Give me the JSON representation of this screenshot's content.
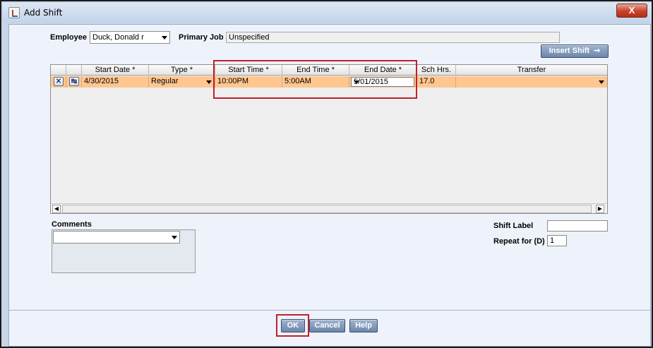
{
  "window": {
    "title": "Add Shift",
    "close_label": "X"
  },
  "employee": {
    "label": "Employee",
    "value": "Duck, Donald r"
  },
  "primary_job": {
    "label": "Primary Job",
    "value": "Unspecified"
  },
  "insert_shift": {
    "label": "Insert Shift"
  },
  "grid": {
    "headers": {
      "start_date": "Start Date *",
      "type": "Type *",
      "start_time": "Start Time *",
      "end_time": "End Time *",
      "end_date": "End Date *",
      "sch_hrs": "Sch Hrs.",
      "transfer": "Transfer"
    },
    "rows": [
      {
        "start_date": "4/30/2015",
        "type": "Regular",
        "start_time": "10:00PM",
        "end_time": "5:00AM",
        "end_date": "5/01/2015",
        "sch_hrs": "17.0",
        "transfer": ""
      }
    ]
  },
  "comments": {
    "label": "Comments",
    "value": ""
  },
  "shift_label": {
    "label": "Shift Label",
    "value": ""
  },
  "repeat_for": {
    "label": "Repeat for (D)",
    "value": "1"
  },
  "footer": {
    "ok": "OK",
    "cancel": "Cancel",
    "help": "Help"
  },
  "colors": {
    "selected_row": "#ffc690",
    "highlight": "#c0202a",
    "button": "#7a90b3"
  },
  "icons": {
    "delete_row": "x-box-icon",
    "edit_row": "edit-row-icon",
    "insert_arrow": "arrow-right-icon"
  }
}
